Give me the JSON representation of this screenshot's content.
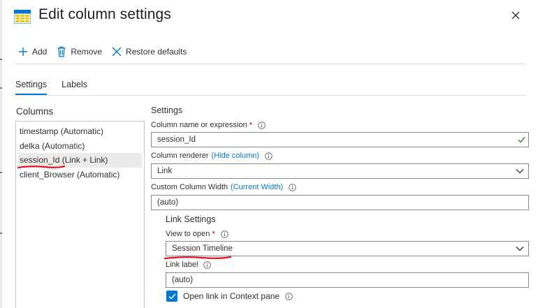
{
  "header": {
    "title": "Edit column settings",
    "icon": "table-grid-icon"
  },
  "toolbar": {
    "add_label": "Add",
    "remove_label": "Remove",
    "restore_label": "Restore defaults"
  },
  "tabs": [
    {
      "label": "Settings",
      "active": true
    },
    {
      "label": "Labels",
      "active": false
    }
  ],
  "columns": {
    "heading": "Columns",
    "items": [
      {
        "label": "timestamp (Automatic)",
        "selected": false
      },
      {
        "label": "delka (Automatic)",
        "selected": false
      },
      {
        "label": "session_Id (Link + Link)",
        "selected": true
      },
      {
        "label": "client_Browser (Automatic)",
        "selected": false
      }
    ]
  },
  "settings": {
    "heading": "Settings",
    "column_name": {
      "label": "Column name or expression",
      "required_mark": "*",
      "value": "session_Id"
    },
    "column_renderer": {
      "label": "Column renderer",
      "link": "(Hide column)",
      "value": "Link"
    },
    "custom_width": {
      "label": "Custom Column Width",
      "link": "(Current Width)",
      "value": "(auto)"
    },
    "link_settings": {
      "heading": "Link Settings",
      "view_to_open": {
        "label": "View to open",
        "required_mark": "*",
        "value": "Session Timeline"
      },
      "link_label": {
        "label": "Link label",
        "value": "(auto)"
      },
      "open_in_context": {
        "label": "Open link in Context pane",
        "checked": true
      }
    }
  },
  "colors": {
    "accent": "#0078d4",
    "required": "#a4262c",
    "valid": "#107c10",
    "annotation": "#e81123"
  }
}
